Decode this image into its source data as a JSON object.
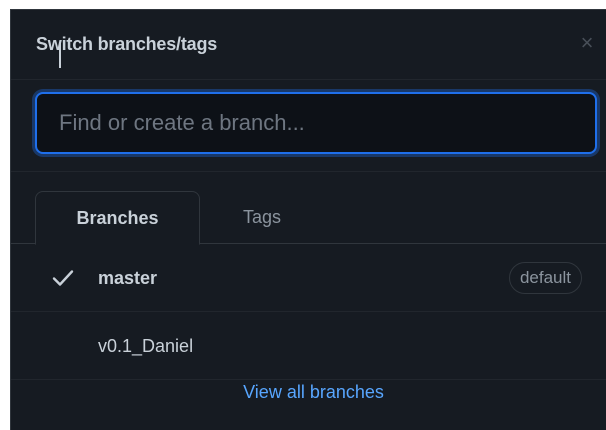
{
  "header": {
    "title": "Switch branches/tags",
    "close_label": "×"
  },
  "search": {
    "placeholder": "Find or create a branch..."
  },
  "tabs": [
    {
      "label": "Branches",
      "active": true
    },
    {
      "label": "Tags",
      "active": false
    }
  ],
  "branches": [
    {
      "name": "master",
      "selected": true,
      "badge": "default"
    },
    {
      "name": "v0.1_Daniel",
      "selected": false
    }
  ],
  "footer": {
    "link_label": "View all branches"
  },
  "colors": {
    "panel_bg": "#161b22",
    "input_bg": "#0d1117",
    "focus_border": "#1f6feb",
    "link": "#58a6ff",
    "text": "#c9d1d9",
    "muted": "#8b949e"
  },
  "icons": {
    "close": "close-icon",
    "selected": "check-icon"
  }
}
